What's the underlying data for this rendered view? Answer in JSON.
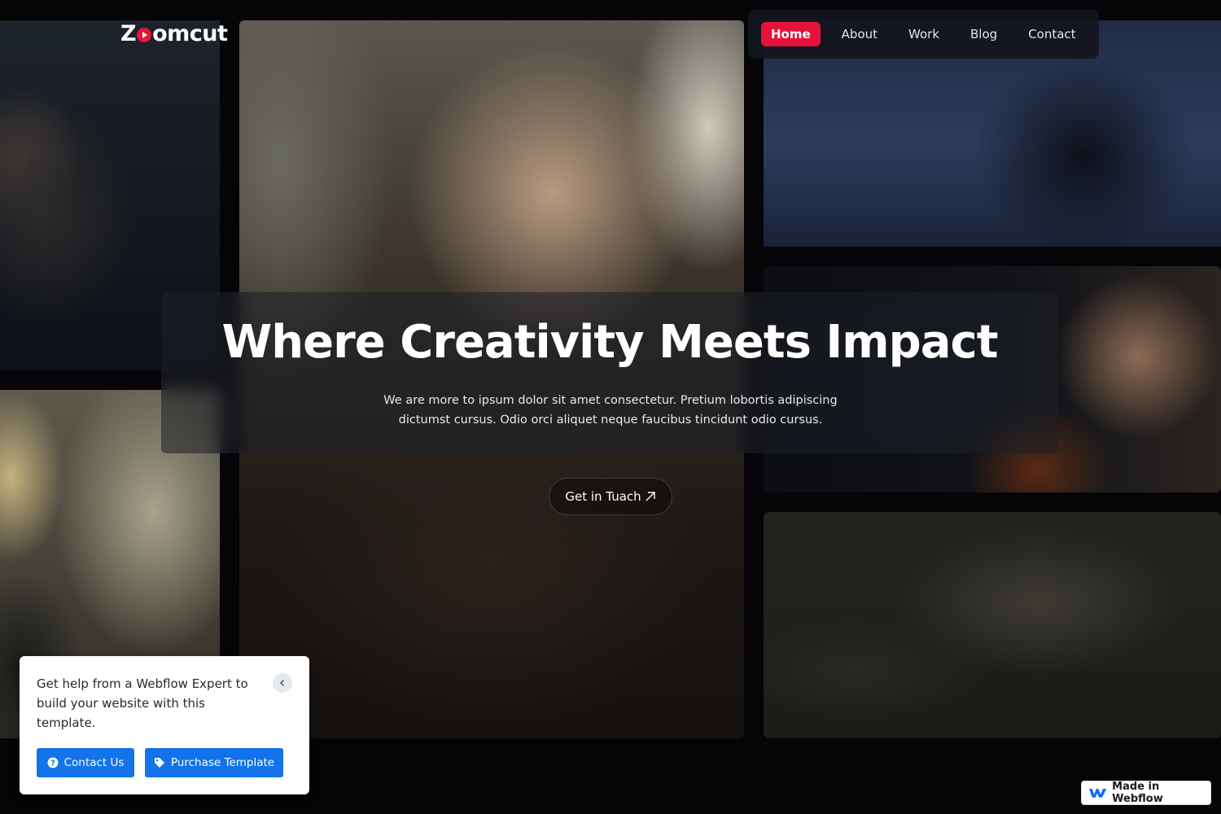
{
  "brand": {
    "logo_prefix": "Z",
    "logo_suffix": "omcut",
    "accent_color": "#e5133a"
  },
  "nav": {
    "items": [
      {
        "label": "Home",
        "active": true
      },
      {
        "label": "About",
        "active": false
      },
      {
        "label": "Work",
        "active": false
      },
      {
        "label": "Blog",
        "active": false
      },
      {
        "label": "Contact",
        "active": false
      }
    ]
  },
  "hero": {
    "title": "Where Creativity Meets Impact",
    "subtitle": "We are more to ipsum dolor sit amet consectetur. Pretium lobortis adipiscing dictumst cursus. Odio orci aliquet neque faucibus tincidunt odio cursus.",
    "cta_label": "Get in Tuach",
    "cta_icon": "arrow-up-right-icon"
  },
  "help_card": {
    "text": "Get help from a Webflow Expert to build your website with this template.",
    "contact_label": "Contact Us",
    "purchase_label": "Purchase Template",
    "button_color": "#1273eb"
  },
  "badge": {
    "label": "Made in Webflow"
  }
}
